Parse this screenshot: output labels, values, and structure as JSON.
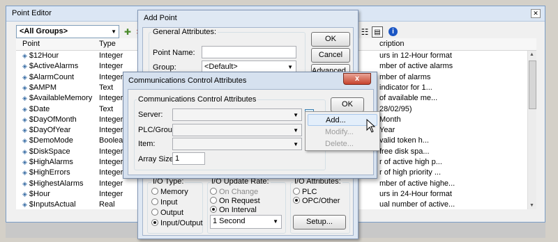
{
  "point_editor": {
    "title": "Point Editor",
    "group_select": "<All Groups>",
    "columns": {
      "point": "Point",
      "type": "Type",
      "description": "cription"
    },
    "rows": [
      {
        "name": "$12Hour",
        "type": "Integer",
        "desc": "urs in 12-Hour format"
      },
      {
        "name": "$ActiveAlarms",
        "type": "Integer",
        "desc": "mber of active alarms"
      },
      {
        "name": "$AlarmCount",
        "type": "Integer",
        "desc": "mber of alarms"
      },
      {
        "name": "$AMPM",
        "type": "Text",
        "desc": "indicator for 1..."
      },
      {
        "name": "$AvailableMemory",
        "type": "Integer",
        "desc": "of available me..."
      },
      {
        "name": "$Date",
        "type": "Text",
        "desc": "28/02/95)"
      },
      {
        "name": "$DayOfMonth",
        "type": "Integer",
        "desc": "Month"
      },
      {
        "name": "$DayOfYear",
        "type": "Integer",
        "desc": "Year"
      },
      {
        "name": "$DemoMode",
        "type": "Boolean",
        "desc": "valid token h..."
      },
      {
        "name": "$DiskSpace",
        "type": "Integer",
        "desc": "free disk spa..."
      },
      {
        "name": "$HighAlarms",
        "type": "Integer",
        "desc": "r of active high p..."
      },
      {
        "name": "$HighErrors",
        "type": "Integer",
        "desc": "r of high priority ..."
      },
      {
        "name": "$HighestAlarms",
        "type": "Integer",
        "desc": "mber of active highe..."
      },
      {
        "name": "$Hour",
        "type": "Integer",
        "desc": "urs in 24-Hour format"
      },
      {
        "name": "$InputsActual",
        "type": "Real",
        "desc": "ual number of active..."
      }
    ]
  },
  "add_point": {
    "title": "Add Point",
    "general_legend": "General Attributes:",
    "point_name_label": "Point Name:",
    "point_name_value": "",
    "group_label": "Group:",
    "group_value": "<Default>",
    "ok": "OK",
    "cancel": "Cancel",
    "advanced": "Advanced...",
    "io_type_legend": "I/O Type:",
    "io_types": [
      "Memory",
      "Input",
      "Output",
      "Input/Output"
    ],
    "io_type_selected": 3,
    "update_legend": "I/O Update Rate:",
    "update_rates": [
      "On Change",
      "On Request",
      "On Interval"
    ],
    "update_rate_selected": 2,
    "interval_value": "1 Second",
    "attr_legend": "I/O Attributes:",
    "attrs": [
      "PLC",
      "OPC/Other"
    ],
    "attr_selected": 1,
    "setup": "Setup..."
  },
  "comm_dialog": {
    "title": "Communications Control Attributes",
    "close": "x",
    "legend": "Communications Control Attributes",
    "server_label": "Server:",
    "plc_group_label": "PLC/Group:",
    "item_label": "Item:",
    "array_size_label": "Array Size:",
    "array_size_value": "1",
    "ok": "OK"
  },
  "context_menu": {
    "items": [
      {
        "label": "Add...",
        "enabled": true
      },
      {
        "label": "Modify...",
        "enabled": false
      },
      {
        "label": "Delete...",
        "enabled": false
      }
    ]
  }
}
